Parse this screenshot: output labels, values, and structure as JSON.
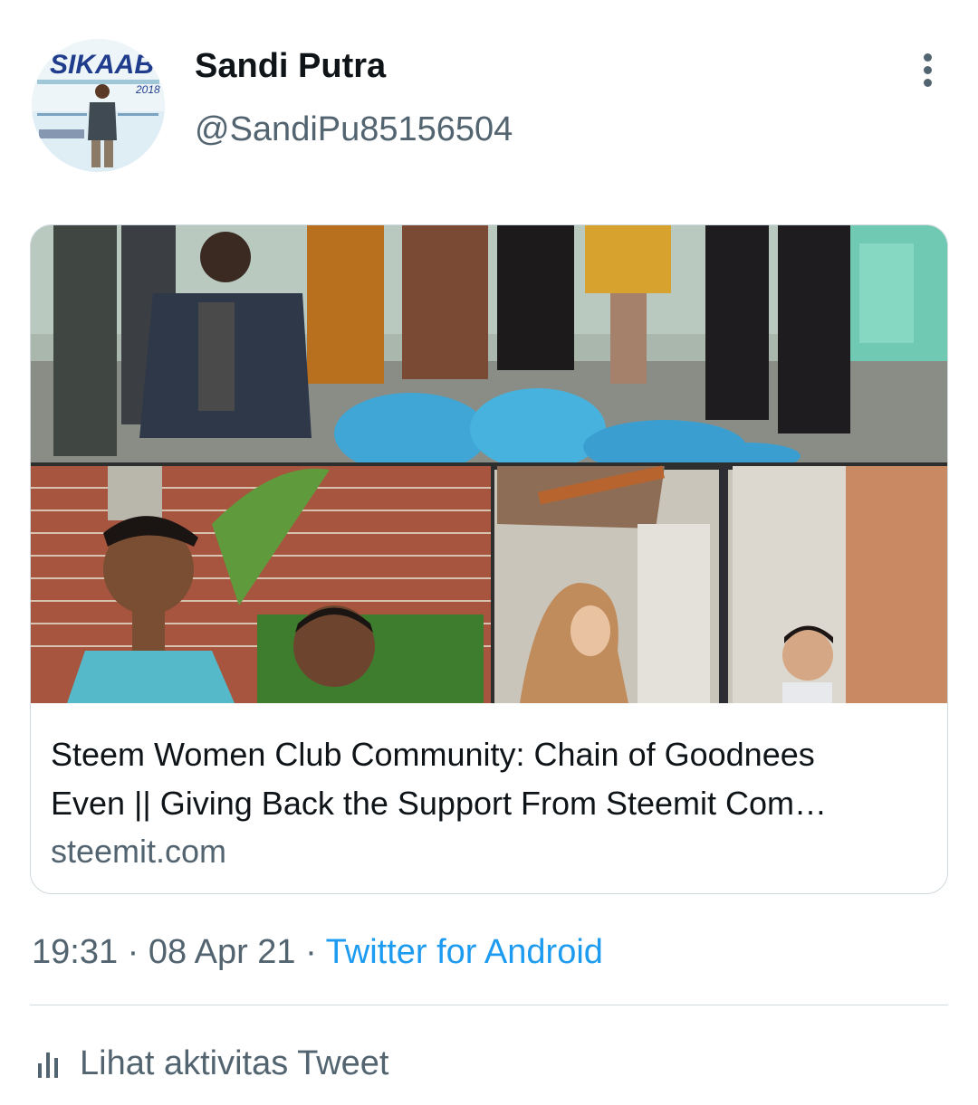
{
  "header": {
    "avatar_icon": "profile-photo",
    "avatar_banner_text": "SIKAAB",
    "avatar_year_text": "2018",
    "name": "Sandi Putra",
    "handle": "@SandiPu85156504",
    "more_icon": "vertical-ellipsis-icon"
  },
  "card": {
    "title_line1": "Steem Women Club Community: Chain of Goodnees",
    "title_line2": "Even || Giving Back the Support From Steemit Com…",
    "domain": "steemit.com"
  },
  "meta": {
    "time": "19:31",
    "separator": "·",
    "date": "08 Apr 21",
    "source": "Twitter for Android"
  },
  "activity": {
    "icon": "bar-chart-icon",
    "label": "Lihat aktivitas Tweet"
  },
  "colors": {
    "primary_text": "#0f1419",
    "secondary_text": "#536471",
    "link": "#1d9bf0",
    "border": "#cfd9de"
  }
}
